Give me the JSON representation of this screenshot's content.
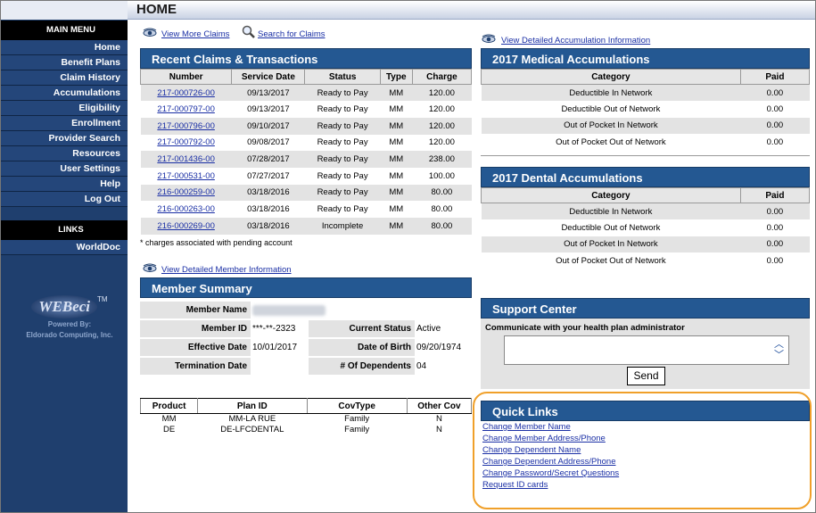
{
  "page": {
    "title": "HOME"
  },
  "sidebar": {
    "menu_header": "MAIN MENU",
    "items": [
      {
        "label": "Home"
      },
      {
        "label": "Benefit Plans"
      },
      {
        "label": "Claim History"
      },
      {
        "label": "Accumulations"
      },
      {
        "label": "Eligibility"
      },
      {
        "label": "Enrollment"
      },
      {
        "label": "Provider Search"
      },
      {
        "label": "Resources"
      },
      {
        "label": "User Settings"
      },
      {
        "label": "Help"
      },
      {
        "label": "Log Out"
      }
    ],
    "links_header": "LINKS",
    "links": [
      {
        "label": "WorldDoc"
      }
    ],
    "logo": {
      "text": "WEBeci",
      "tm": "TM",
      "powered_by": "Powered By:",
      "company": "Eldorado Computing, Inc."
    }
  },
  "top_links": {
    "view_more_claims": "View More Claims",
    "search_claims": "Search for Claims",
    "view_accumulation": "View Detailed Accumulation Information",
    "view_member": "View Detailed Member Information"
  },
  "claims": {
    "title": "Recent Claims & Transactions",
    "columns": [
      "Number",
      "Service Date",
      "Status",
      "Type",
      "Charge"
    ],
    "rows": [
      [
        "217-000726-00",
        "09/13/2017",
        "Ready to Pay",
        "MM",
        "120.00"
      ],
      [
        "217-000797-00",
        "09/13/2017",
        "Ready to Pay",
        "MM",
        "120.00"
      ],
      [
        "217-000796-00",
        "09/10/2017",
        "Ready to Pay",
        "MM",
        "120.00"
      ],
      [
        "217-000792-00",
        "09/08/2017",
        "Ready to Pay",
        "MM",
        "120.00"
      ],
      [
        "217-001436-00",
        "07/28/2017",
        "Ready to Pay",
        "MM",
        "238.00"
      ],
      [
        "217-000531-00",
        "07/27/2017",
        "Ready to Pay",
        "MM",
        "100.00"
      ],
      [
        "216-000259-00",
        "03/18/2016",
        "Ready to Pay",
        "MM",
        "80.00"
      ],
      [
        "216-000263-00",
        "03/18/2016",
        "Ready to Pay",
        "MM",
        "80.00"
      ],
      [
        "216-000269-00",
        "03/18/2016",
        "Incomplete",
        "MM",
        "80.00"
      ]
    ],
    "footnote": "* charges associated with pending account"
  },
  "medical": {
    "title": "2017 Medical Accumulations",
    "columns": [
      "Category",
      "Paid"
    ],
    "rows": [
      [
        "Deductible In Network",
        "0.00"
      ],
      [
        "Deductible Out of Network",
        "0.00"
      ],
      [
        "Out of Pocket In Network",
        "0.00"
      ],
      [
        "Out of Pocket Out of Network",
        "0.00"
      ]
    ]
  },
  "dental": {
    "title": "2017 Dental Accumulations",
    "columns": [
      "Category",
      "Paid"
    ],
    "rows": [
      [
        "Deductible In Network",
        "0.00"
      ],
      [
        "Deductible Out of Network",
        "0.00"
      ],
      [
        "Out of Pocket In Network",
        "0.00"
      ],
      [
        "Out of Pocket Out of Network",
        "0.00"
      ]
    ]
  },
  "member": {
    "title": "Member Summary",
    "labels": {
      "name": "Member Name",
      "id": "Member ID",
      "effective": "Effective Date",
      "termination": "Termination Date",
      "status": "Current Status",
      "dob": "Date of Birth",
      "dependents": "# Of Dependents"
    },
    "values": {
      "id": "***-**-2323",
      "effective": "10/01/2017",
      "termination": "",
      "status": "Active",
      "dob": "09/20/1974",
      "dependents": "04"
    },
    "product_columns": [
      "Product",
      "Plan ID",
      "CovType",
      "Other Cov"
    ],
    "products": [
      [
        "MM",
        "MM-LA RUE",
        "Family",
        "N"
      ],
      [
        "DE",
        "DE-LFCDENTAL",
        "Family",
        "N"
      ]
    ]
  },
  "support": {
    "title": "Support Center",
    "label": "Communicate with your health plan administrator",
    "message_value": "",
    "send_label": "Send"
  },
  "quick_links": {
    "title": "Quick Links",
    "links": [
      "Change Member Name",
      "Change Member Address/Phone",
      "Change Dependent Name",
      "Change Dependent Address/Phone",
      "Change Password/Secret Questions",
      "Request ID cards"
    ]
  },
  "colors": {
    "panel_header": "#245892",
    "sidebar": "#1f3f6e",
    "link": "#1a2fa5",
    "highlight": "#f0a02a"
  }
}
